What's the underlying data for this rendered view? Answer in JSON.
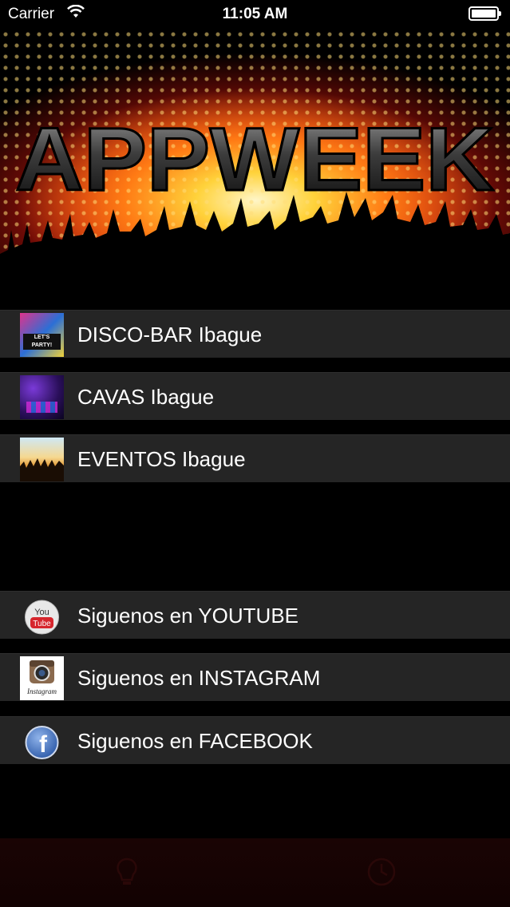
{
  "status_bar": {
    "carrier": "Carrier",
    "time": "11:05 AM"
  },
  "banner": {
    "logo_text": "APPWEEK"
  },
  "menu": [
    {
      "label": "DISCO-BAR Ibague",
      "thumb_text": "LET'S PARTY!"
    },
    {
      "label": "CAVAS Ibague"
    },
    {
      "label": "EVENTOS Ibague"
    }
  ],
  "social": [
    {
      "label": "Siguenos en YOUTUBE",
      "icon_line1": "You",
      "icon_line2": "Tube"
    },
    {
      "label": "Siguenos en INSTAGRAM",
      "icon_text": "Instagram"
    },
    {
      "label": "Siguenos en FACEBOOK",
      "icon_text": "f"
    }
  ],
  "colors": {
    "row_bg": "#252525",
    "background": "#000000",
    "tabbar": "#1a0404"
  }
}
